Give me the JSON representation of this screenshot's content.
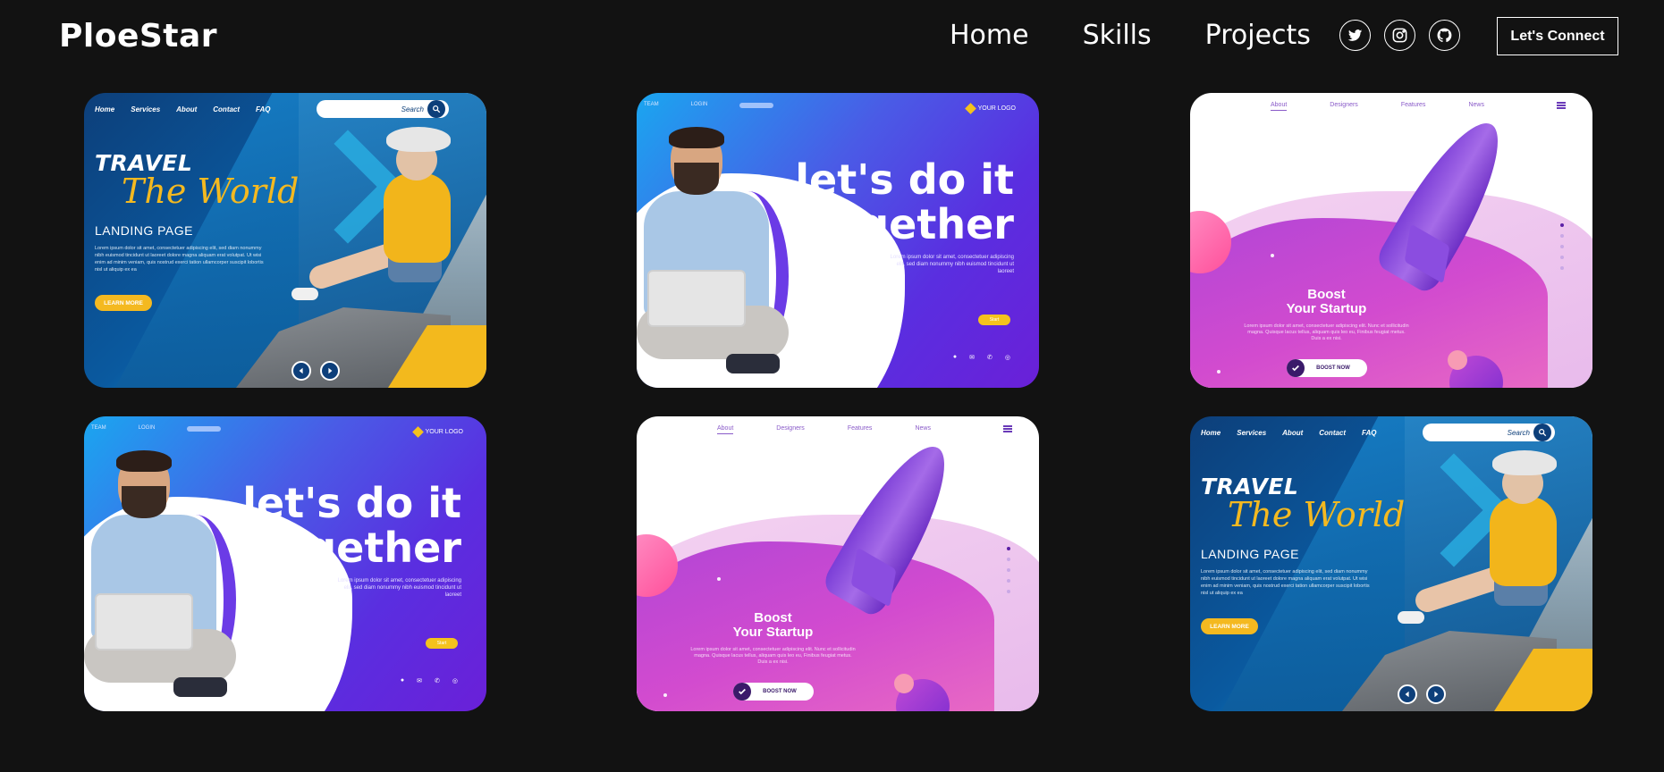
{
  "brand": "PloeStar",
  "nav": {
    "links": [
      "Home",
      "Skills",
      "Projects"
    ],
    "connect_label": "Let's Connect"
  },
  "socials": [
    "twitter-icon",
    "instagram-icon",
    "github-icon"
  ],
  "colors": {
    "background": "#121212",
    "accent_yellow": "#f4b920",
    "travel_blue": "#0d3f7a",
    "together_purple": "#5a2ee0",
    "startup_pink": "#d24bcf"
  },
  "travel": {
    "nav": [
      "Home",
      "Services",
      "About",
      "Contact",
      "FAQ"
    ],
    "search": "Search",
    "title": "TRAVEL",
    "script": "The World",
    "subtitle": "LANDING PAGE",
    "lorem": "Lorem ipsum dolor sit amet, consectetuer adipiscing elit, sed diam nonummy nibh euismod tincidunt ut laoreet dolore magna aliquam erat volutpat. Ut wisi enim ad minim veniam, quis nostrud exerci tation ullamcorper suscipit lobortis nisl ut aliquip ex ea",
    "button": "LEARN MORE"
  },
  "together": {
    "top_left": [
      "TEAM",
      "LOGIN"
    ],
    "logo": "YOUR LOGO",
    "title_line1": "let's do it",
    "title_line2": "together",
    "lorem": "Lorem ipsum dolor sit amet, consectetuer adipiscing elit, sed diam nonummy nibh euismod tincidunt ut laoreet",
    "button": "Start"
  },
  "startup": {
    "nav": [
      "About",
      "Designers",
      "Features",
      "News"
    ],
    "title_line1": "Boost",
    "title_line2": "Your Startup",
    "lorem": "Lorem ipsum dolor sit amet, consectetuer adipiscing elit. Nunc et sollicitudin magna. Quisque lacus tellus, aliquam quis leo eu, Finibus feugiat metus. Duis a ex nisi.",
    "button": "BOOST NOW"
  }
}
